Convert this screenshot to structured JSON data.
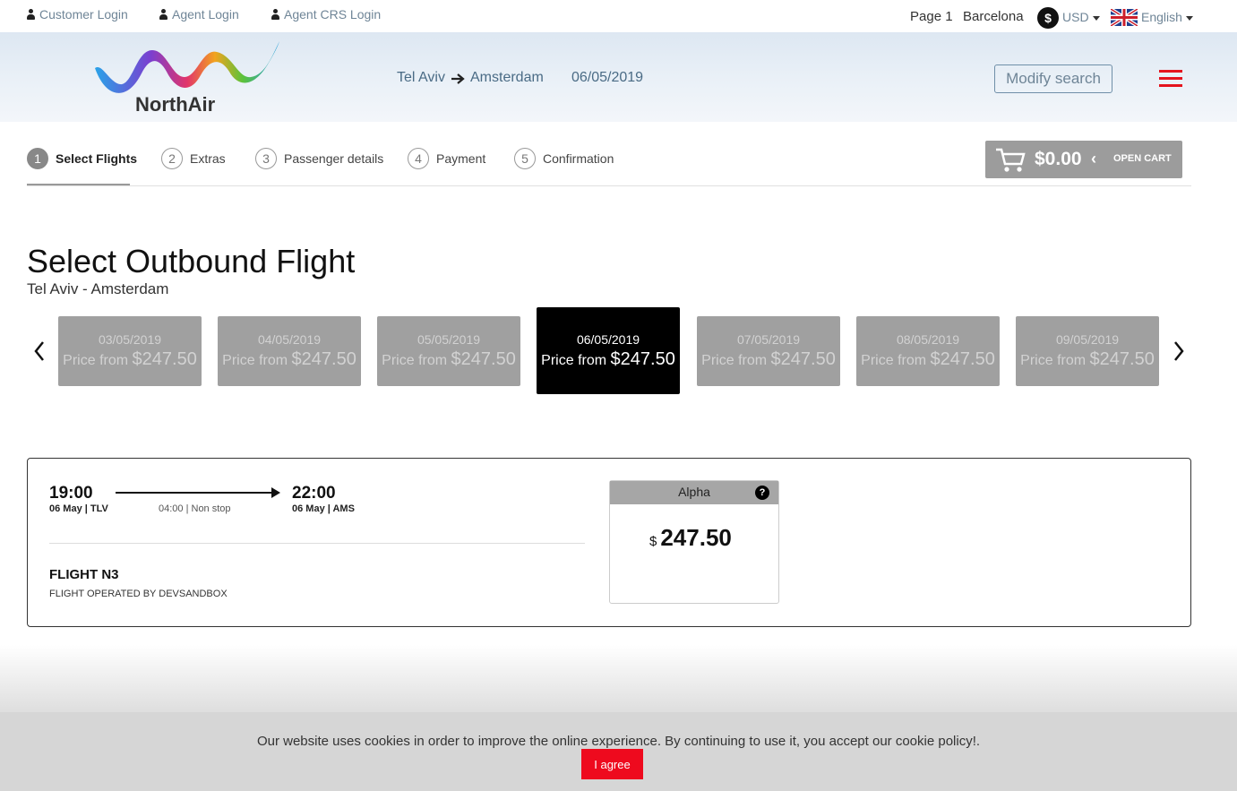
{
  "topbar": {
    "customer_login": "Customer Login",
    "agent_login": "Agent Login",
    "agent_crs_login": "Agent CRS Login",
    "page": "Page 1",
    "city": "Barcelona",
    "currency_symbol": "$",
    "currency": "USD",
    "language": "English"
  },
  "header": {
    "logo_text": "NorthAir",
    "origin": "Tel Aviv",
    "destination": "Amsterdam",
    "date": "06/05/2019",
    "modify_label": "Modify search"
  },
  "steps": [
    {
      "num": "1",
      "label": "Select Flights"
    },
    {
      "num": "2",
      "label": "Extras"
    },
    {
      "num": "3",
      "label": "Passenger details"
    },
    {
      "num": "4",
      "label": "Payment"
    },
    {
      "num": "5",
      "label": "Confirmation"
    }
  ],
  "cart": {
    "amount": "$0.00",
    "chevron": "‹",
    "open_label": "OPEN CART"
  },
  "page": {
    "title": "Select Outbound Flight",
    "subtitle": "Tel Aviv - Amsterdam"
  },
  "dates": [
    {
      "date": "03/05/2019",
      "prefix": "Price from",
      "price": "$247.50"
    },
    {
      "date": "04/05/2019",
      "prefix": "Price from",
      "price": "$247.50"
    },
    {
      "date": "05/05/2019",
      "prefix": "Price from",
      "price": "$247.50"
    },
    {
      "date": "06/05/2019",
      "prefix": "Price from",
      "price": "$247.50"
    },
    {
      "date": "07/05/2019",
      "prefix": "Price from",
      "price": "$247.50"
    },
    {
      "date": "08/05/2019",
      "prefix": "Price from",
      "price": "$247.50"
    },
    {
      "date": "09/05/2019",
      "prefix": "Price from",
      "price": "$247.50"
    }
  ],
  "flight": {
    "depart_time": "19:00",
    "depart_info": "06 May | TLV",
    "arrive_time": "22:00",
    "arrive_info": "06 May | AMS",
    "duration": "04:00 | Non stop",
    "number": "FLIGHT N3",
    "operator": "FLIGHT OPERATED BY DEVSANDBOX",
    "fare_name": "Alpha",
    "fare_help": "?",
    "fare_currency": "$",
    "fare_price": "247.50"
  },
  "cookie": {
    "text": "Our website uses cookies in order to improve the online experience. By continuing to use it, you accept our cookie policy!.",
    "agree": "I agree"
  },
  "colors": {
    "accent_red": "#ee0a1e",
    "steel_blue": "#4a6b85",
    "selected_date": "#000000",
    "date_card": "#a0a0a0"
  }
}
